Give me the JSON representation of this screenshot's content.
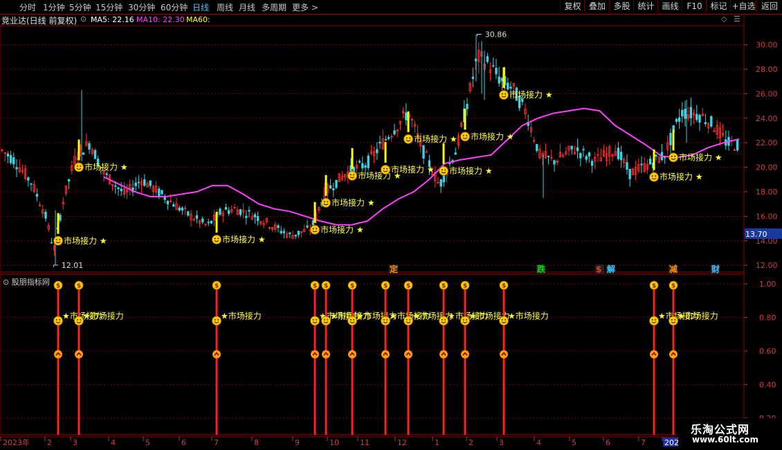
{
  "toolbar": {
    "periods": [
      {
        "label": "分时",
        "active": false
      },
      {
        "label": "1分钟",
        "active": false
      },
      {
        "label": "5分钟",
        "active": false
      },
      {
        "label": "15分钟",
        "active": false
      },
      {
        "label": "30分钟",
        "active": false
      },
      {
        "label": "60分钟",
        "active": false
      },
      {
        "label": "日线",
        "active": true
      },
      {
        "label": "周线",
        "active": false
      },
      {
        "label": "月线",
        "active": false
      },
      {
        "label": "多周期",
        "active": false
      },
      {
        "label": "更多",
        "active": false
      }
    ],
    "right_buttons": [
      "复权",
      "叠加",
      "多股",
      "统计",
      "画线",
      "F10",
      "标记",
      "+自选",
      "返回"
    ]
  },
  "info": {
    "title": "竞业达(日线 前复权)",
    "ma5": "MA5: 22.16",
    "ma10": "MA10: 22.30",
    "ma60": "MA60:",
    "colors": {
      "ma5": "#ffffff",
      "ma10": "#ff40ff",
      "ma60": "#ffff00"
    }
  },
  "price_axis": {
    "ticks": [
      "30.00",
      "28.00",
      "26.00",
      "24.00",
      "22.00",
      "20.00",
      "18.00",
      "16.00",
      "14.00",
      "12.00"
    ],
    "current": "13.70",
    "high_label": "30.86",
    "low_label": "12.01"
  },
  "signal_label": "市场接力",
  "event_marks": [
    {
      "text": "定",
      "color": "#ff8c00"
    },
    {
      "text": "跌",
      "color": "#00e000"
    },
    {
      "text": "$",
      "color": "#ff3030"
    },
    {
      "text": "解",
      "color": "#40c0ff"
    },
    {
      "text": "减",
      "color": "#ff8c00"
    },
    {
      "text": "财",
      "color": "#40c0ff"
    }
  ],
  "indicator": {
    "title": "股朋指标网",
    "ticks": [
      "1.00",
      "0.80",
      "0.60",
      "0.40",
      "0.20"
    ]
  },
  "date_axis": {
    "labels": [
      "2023年",
      "2",
      "3",
      "4",
      "5",
      "6",
      "7",
      "8",
      "9",
      "10",
      "11",
      "12",
      "1",
      "2",
      "3",
      "4",
      "5",
      "6",
      "7",
      "202"
    ]
  },
  "watermark": {
    "line1": "乐淘公式网",
    "line2": "www.60lt.com"
  },
  "chart_data": {
    "type": "candlestick",
    "ylim": [
      11.5,
      31.5
    ],
    "ma_line": {
      "name": "MA10",
      "color": "#ff40ff",
      "values": [
        19.2,
        18.6,
        18.0,
        17.6,
        17.6,
        17.8,
        18.0,
        18.5,
        18.5,
        17.8,
        17.0,
        16.6,
        16.4,
        16.0,
        15.6,
        15.3,
        15.3,
        15.6,
        16.6,
        17.4,
        18.0,
        19.0,
        20.3,
        20.6,
        20.8,
        21.0,
        22.2,
        23.4,
        24.0,
        24.4,
        24.6,
        24.8,
        24.6,
        23.4,
        22.6,
        21.8,
        20.9,
        20.8,
        21.0,
        21.6,
        22.0,
        22.3
      ]
    },
    "signals_price": [
      14.0,
      20.0,
      14.1,
      14.9,
      17.1,
      19.3,
      19.8,
      22.3,
      19.7,
      22.5,
      25.9,
      19.2,
      20.8
    ],
    "indicator_signals": [
      1.0,
      1.0,
      1.0,
      1.0,
      1.0,
      1.0,
      1.0,
      1.0,
      1.0,
      1.0,
      1.0,
      1.0,
      1.0
    ]
  }
}
